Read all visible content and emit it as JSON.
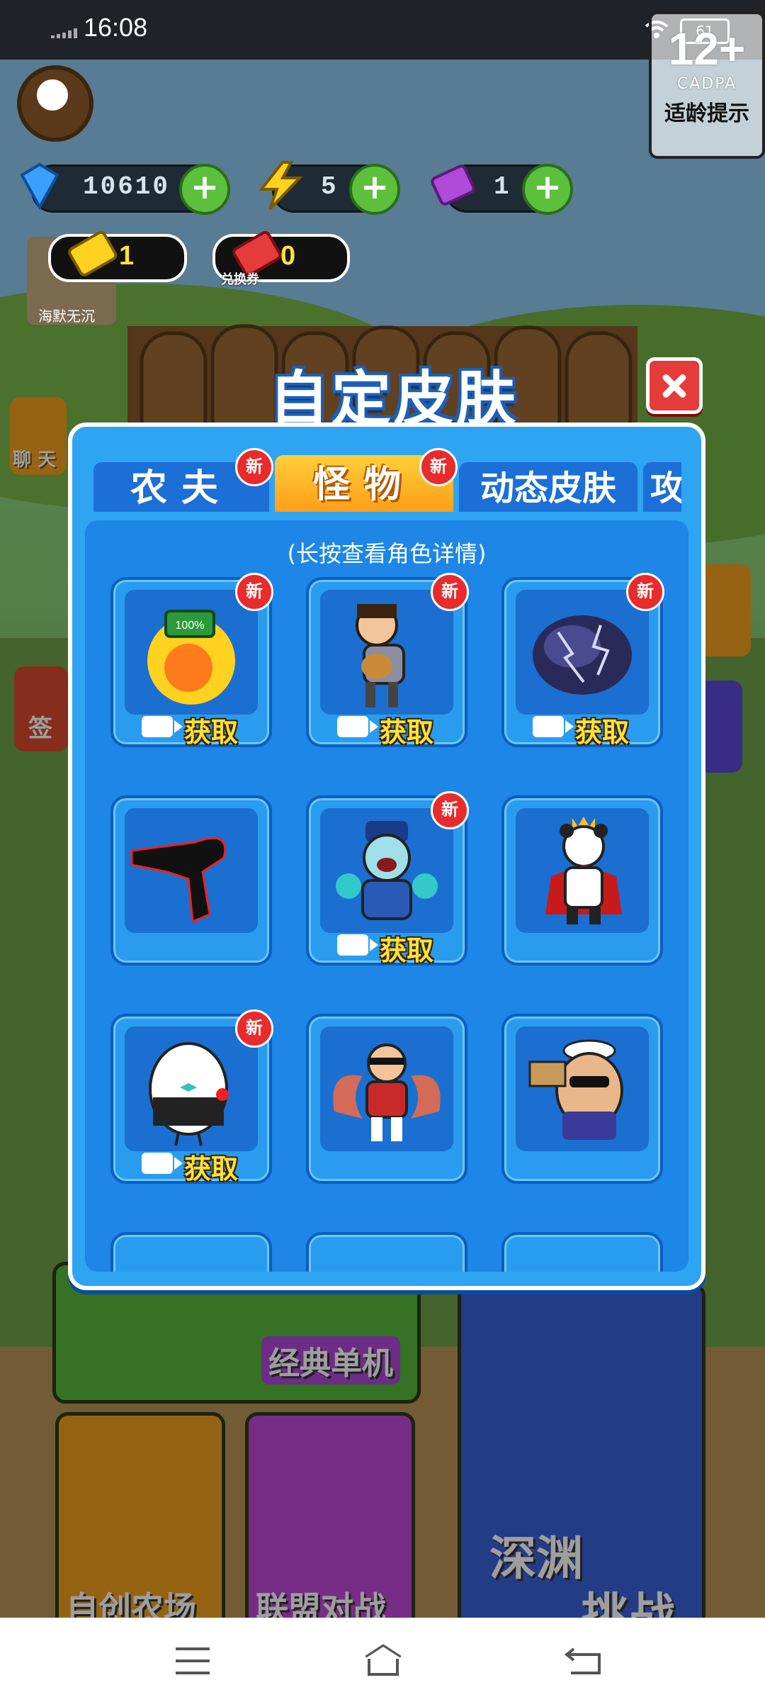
{
  "status_bar": {
    "time": "16:08",
    "battery": "61"
  },
  "age_rating": {
    "age": "12+",
    "org": "CADPA",
    "tip": "适龄提示"
  },
  "resources": [
    {
      "name": "diamond",
      "value": "10610",
      "color": "#3aa0ff"
    },
    {
      "name": "energy",
      "value": "5",
      "color": "#ffd21f"
    },
    {
      "name": "ticket",
      "value": "1",
      "color": "#b04ad8"
    }
  ],
  "tickets": [
    {
      "name": "gold-ticket",
      "value": "1",
      "sub": ""
    },
    {
      "name": "exchange-ticket",
      "value": "0",
      "sub": "兑换券"
    }
  ],
  "player_name": "海默无沉",
  "side_left": {
    "chat": "聊 天",
    "sign": "签"
  },
  "modal": {
    "title": "自定皮肤",
    "tabs": [
      {
        "label": "农夫",
        "new": true,
        "active": false
      },
      {
        "label": "怪物",
        "new": true,
        "active": true
      },
      {
        "label": "动态皮肤",
        "new": false,
        "active": false
      },
      {
        "label": "攻",
        "new": false,
        "active": false
      }
    ],
    "hint": "(长按查看角色详情)",
    "new_badge": "新",
    "get_label": "获取",
    "skins": [
      {
        "name": "battery-bomb",
        "new": true,
        "get": true
      },
      {
        "name": "running-thief",
        "new": true,
        "get": true
      },
      {
        "name": "storm-cloud",
        "new": true,
        "get": true
      },
      {
        "name": "shadow-figure",
        "new": false,
        "get": false
      },
      {
        "name": "jiangshi",
        "new": true,
        "get": true
      },
      {
        "name": "panda-king",
        "new": false,
        "get": false
      },
      {
        "name": "egg-gentleman",
        "new": true,
        "get": true
      },
      {
        "name": "fox-boy",
        "new": false,
        "get": false
      },
      {
        "name": "sailor-egg",
        "new": false,
        "get": false
      }
    ]
  },
  "background_menu": {
    "classic": "经典单机",
    "create": "自创农场",
    "alliance": "联盟对战",
    "abyss_1": "深渊",
    "abyss_2": "挑战"
  }
}
